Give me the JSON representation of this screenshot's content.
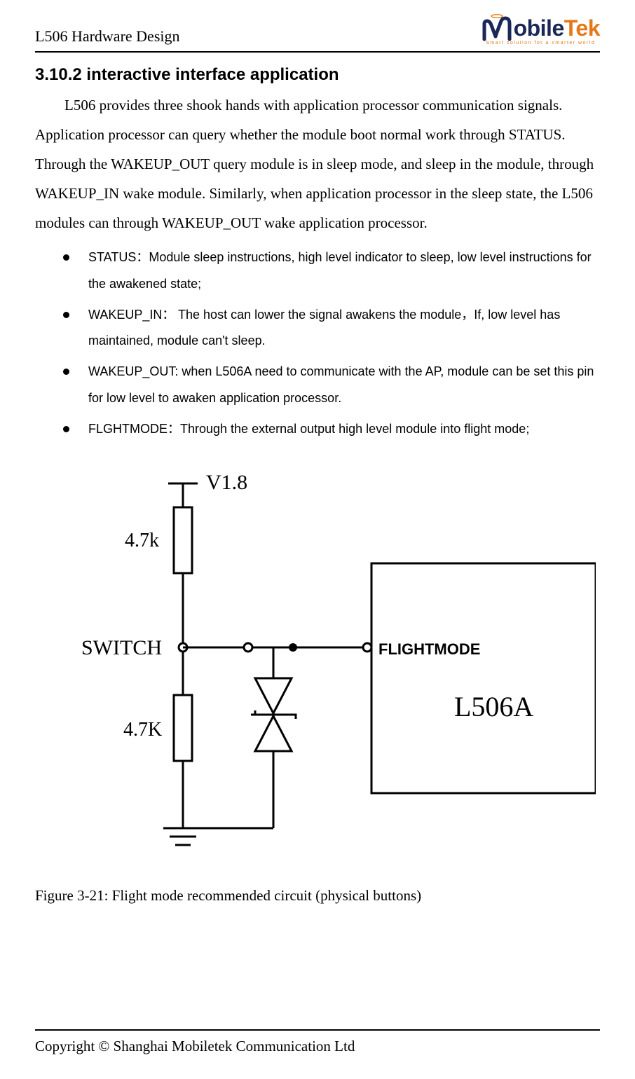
{
  "header": {
    "doc_title": "L506 Hardware Design",
    "logo": {
      "brand_navy": "obile",
      "brand_orange": "Tek",
      "tagline": "Smart solution for a smarter world"
    }
  },
  "section": {
    "number": "3.10.2",
    "title": "interactive interface application"
  },
  "intro": "L506 provides three shook hands with application processor communication signals. Application processor can query whether the module boot normal work through STATUS. Through the WAKEUP_OUT query module is in sleep mode, and sleep in the module, through WAKEUP_IN wake module. Similarly, when application processor in the sleep state, the L506 modules can through WAKEUP_OUT wake application processor.",
  "bullets": [
    " STATUS：Module sleep instructions, high level indicator to sleep, low level instructions for the awakened state;",
    "WAKEUP_IN： The host can lower the signal awakens the module，If, low level has maintained, module can't sleep.",
    "WAKEUP_OUT: when L506A need to communicate with the AP, module can be set this pin for low level to awaken application processor.",
    "FLGHTMODE：Through the external output high level module into flight mode;"
  ],
  "diagram": {
    "voltage_label": "V1.8",
    "resistor_top": "4.7k",
    "switch_label": "SWITCH",
    "resistor_bottom": "4.7K",
    "pin_label": "FLIGHTMODE",
    "module_label": "L506A"
  },
  "figure_caption": "Figure 3-21: Flight mode recommended circuit (physical buttons)",
  "footer": "Copyright © Shanghai Mobiletek Communication Ltd"
}
